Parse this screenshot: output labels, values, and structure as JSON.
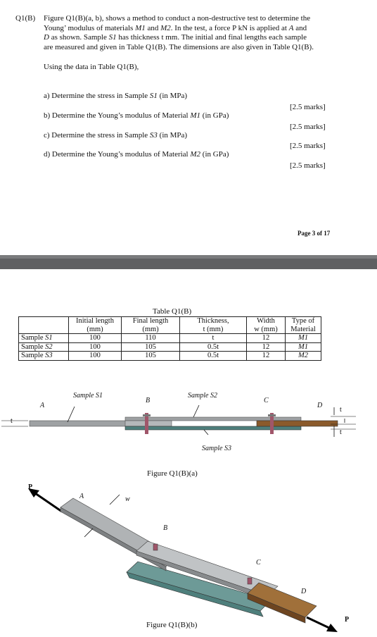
{
  "question": {
    "number": "Q1(B)",
    "line1": "Figure Q1(B)(a, b), shows a method to conduct a non-destructive test to determine the",
    "line2_a": "Young’ modulus of materials ",
    "line2_m1": "M1",
    "line2_b": " and ",
    "line2_m2": "M2",
    "line2_c": ". In the test, a force P kN is applied at ",
    "line2_A": "A",
    "line2_d": " and",
    "line3_D": "D",
    "line3_a": " as shown. Sample ",
    "line3_s1": "S1",
    "line3_b": " has thickness t mm. The initial and final lengths each sample",
    "line4": "are measured and given in Table Q1(B). The dimensions are also given in Table Q1(B).",
    "using": "Using the data in Table Q1(B),",
    "parts": [
      {
        "prefix": "a) Determine the stress in Sample ",
        "var": "S1",
        "suffix": " (in MPa)",
        "marks": "[2.5 marks]"
      },
      {
        "prefix": "b) Determine the Young’s modulus of Material ",
        "var": "M1",
        "suffix": " (in GPa)",
        "marks": "[2.5 marks]"
      },
      {
        "prefix": "c) Determine the stress in Sample ",
        "var": "S3",
        "suffix": " (in MPa)",
        "marks": "[2.5 marks]"
      },
      {
        "prefix": "d) Determine the Young’s modulus of Material ",
        "var": "M2",
        "suffix": " (in GPa)",
        "marks": "[2.5 marks]"
      }
    ],
    "page_footer": "Page 3 of 17"
  },
  "table": {
    "caption": "Table Q1(B)",
    "headers": [
      [
        "",
        ""
      ],
      [
        "Initial length",
        "(mm)"
      ],
      [
        "Final length",
        "(mm)"
      ],
      [
        "Thickness,",
        "t (mm)"
      ],
      [
        "Width",
        "w (mm)"
      ],
      [
        "Type of",
        "Material"
      ]
    ],
    "rows": [
      {
        "sample": "Sample ",
        "sample_var": "S1",
        "initial": "100",
        "final": "110",
        "thickness": "t",
        "width": "12",
        "material": "M1"
      },
      {
        "sample": "Sample ",
        "sample_var": "S2",
        "initial": "100",
        "final": "105",
        "thickness": "0.5t",
        "width": "12",
        "material": "M1"
      },
      {
        "sample": "Sample ",
        "sample_var": "S3",
        "initial": "100",
        "final": "105",
        "thickness": "0.5t",
        "width": "12",
        "material": "M2"
      }
    ]
  },
  "figure_a": {
    "caption": "Figure Q1(B)(a)",
    "labels": {
      "sample_s1": "Sample S1",
      "sample_s2": "Sample S2",
      "sample_s3": "Sample S3",
      "A": "A",
      "B": "B",
      "C": "C",
      "D": "D",
      "t": "t"
    }
  },
  "figure_b": {
    "caption": "Figure Q1(B)(b)",
    "labels": {
      "P_left": "P",
      "P_right": "P",
      "A": "A",
      "B": "B",
      "C": "C",
      "D": "D",
      "w": "w"
    }
  },
  "colors": {
    "separator": "#5f6062",
    "grey_bar": "#9ea1a3",
    "teal_bar": "#4e7f7c",
    "brown_block": "#8b5a2b",
    "bolt": "#a0566a"
  }
}
